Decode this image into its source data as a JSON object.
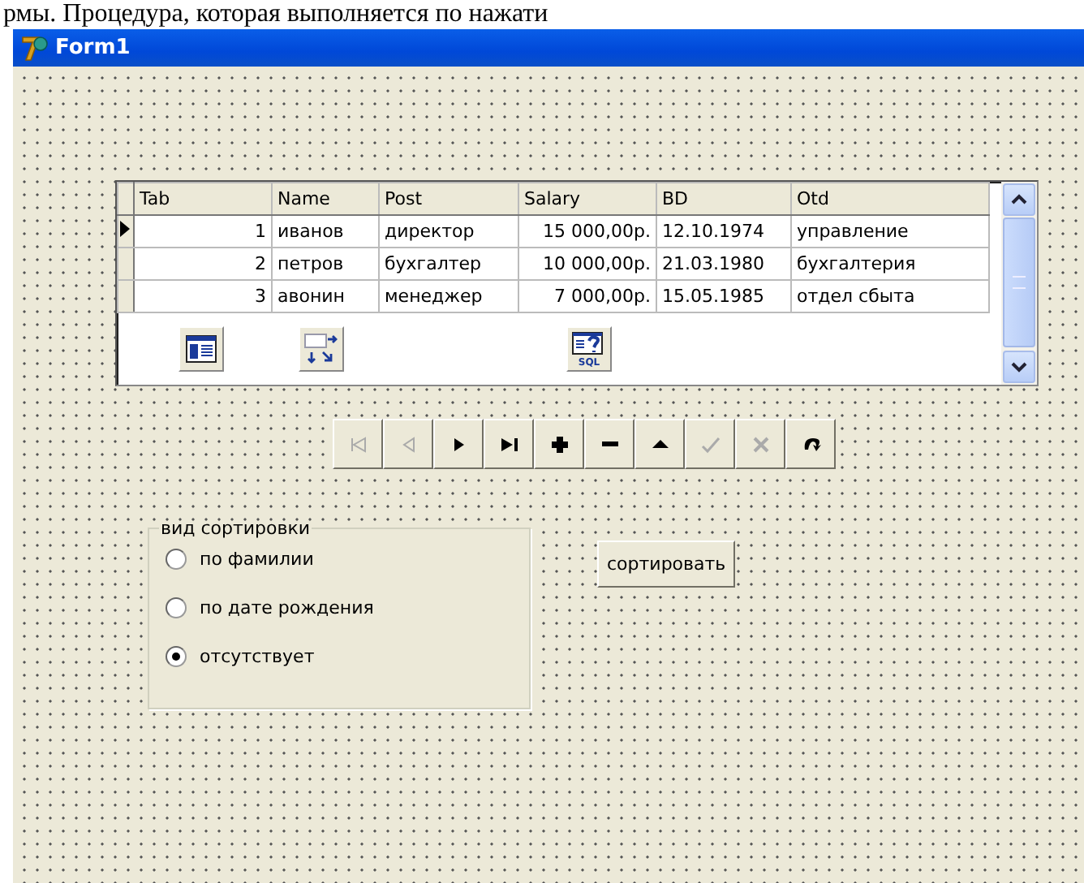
{
  "caption": "рмы. Процедура, которая выполняется по нажати",
  "window": {
    "title": "Form1"
  },
  "grid": {
    "columns": [
      "Tab",
      "Name",
      "Post",
      "Salary",
      "BD",
      "Otd"
    ],
    "rows": [
      {
        "current": true,
        "cells": [
          "1",
          "иванов",
          "директор",
          "15 000,00р.",
          "12.10.1974",
          "управление"
        ]
      },
      {
        "current": false,
        "cells": [
          "2",
          "петров",
          "бухгалтер",
          "10 000,00р.",
          "21.03.1980",
          "бухгалтерия"
        ]
      },
      {
        "current": false,
        "cells": [
          "3",
          "авонин",
          "менеджер",
          "7 000,00р.",
          "15.05.1985",
          "отдел сбыта"
        ]
      }
    ]
  },
  "components": [
    {
      "kind": "datasource"
    },
    {
      "kind": "provider"
    },
    {
      "kind": "query",
      "label": "SQL"
    }
  ],
  "navigator": [
    {
      "kind": "first",
      "enabled": false
    },
    {
      "kind": "prior",
      "enabled": false
    },
    {
      "kind": "next",
      "enabled": true
    },
    {
      "kind": "last",
      "enabled": true
    },
    {
      "kind": "insert",
      "enabled": true
    },
    {
      "kind": "delete",
      "enabled": true
    },
    {
      "kind": "edit",
      "enabled": true
    },
    {
      "kind": "post",
      "enabled": false
    },
    {
      "kind": "cancel",
      "enabled": false
    },
    {
      "kind": "refresh",
      "enabled": true
    }
  ],
  "sort_group": {
    "title": "вид сортировки",
    "options": [
      {
        "label": "по фамилии",
        "selected": false
      },
      {
        "label": "по дате рождения",
        "selected": false
      },
      {
        "label": "отсутствует",
        "selected": true
      }
    ]
  },
  "sort_button": "сортировать"
}
